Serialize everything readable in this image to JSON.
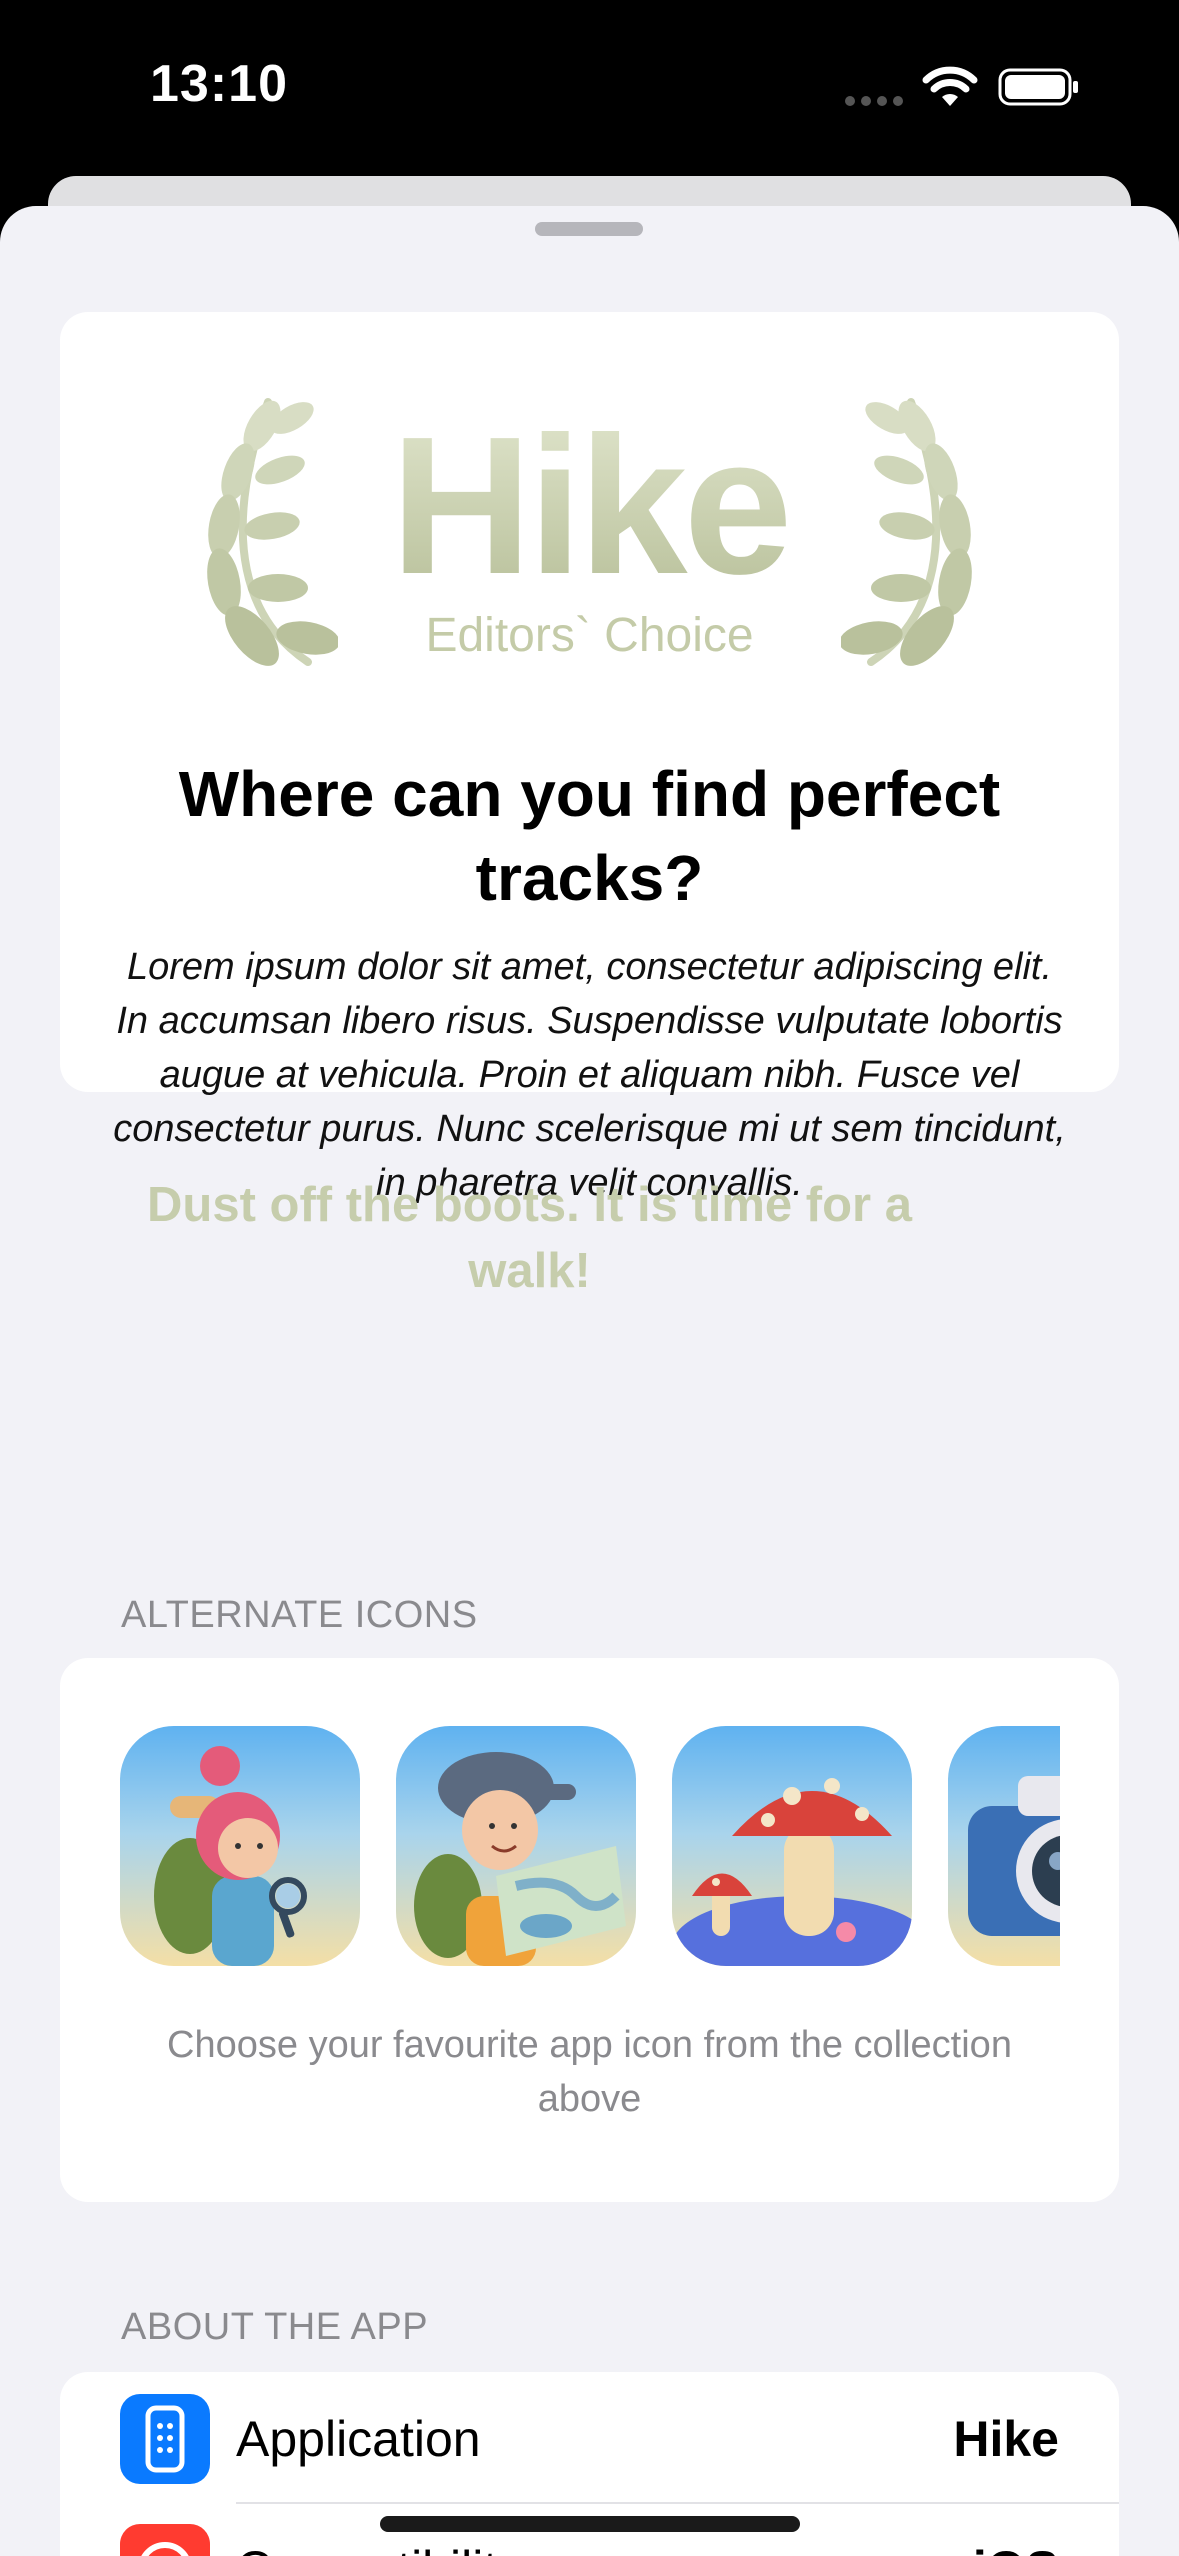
{
  "status_bar": {
    "time": "13:10"
  },
  "hero": {
    "logo_word": "Hike",
    "logo_subtitle": "Editors` Choice",
    "title": "Where can you find perfect tracks?",
    "body": "Lorem ipsum dolor sit amet, consectetur adipiscing elit. In accumsan libero risus. Suspendisse vulputate lobortis augue at vehicula. Proin et aliquam nibh. Fusce vel consectetur purus. Nunc scelerisque mi ut sem tincidunt, in pharetra velit convallis.",
    "tagline": "Dust off the boots. It is time for a walk!"
  },
  "alternate_icons": {
    "header": "ALTERNATE ICONS",
    "icons": [
      "hiker-girl-icon",
      "hiker-boy-map-icon",
      "mushroom-icon",
      "camera-icon"
    ],
    "caption": "Choose your favourite app icon from the collection above"
  },
  "about": {
    "header": "ABOUT THE APP",
    "rows": [
      {
        "label": "Application",
        "value": "Hike",
        "icon": "apps-iphone-icon",
        "icon_color": "#0a7aff"
      },
      {
        "label": "Compatibility",
        "value": "iOS",
        "icon": "info-icon",
        "icon_color": "#ff3b30"
      }
    ]
  },
  "colors": {
    "accent_sage": "#c6cdac",
    "sheet_bg": "#f2f2f7"
  }
}
